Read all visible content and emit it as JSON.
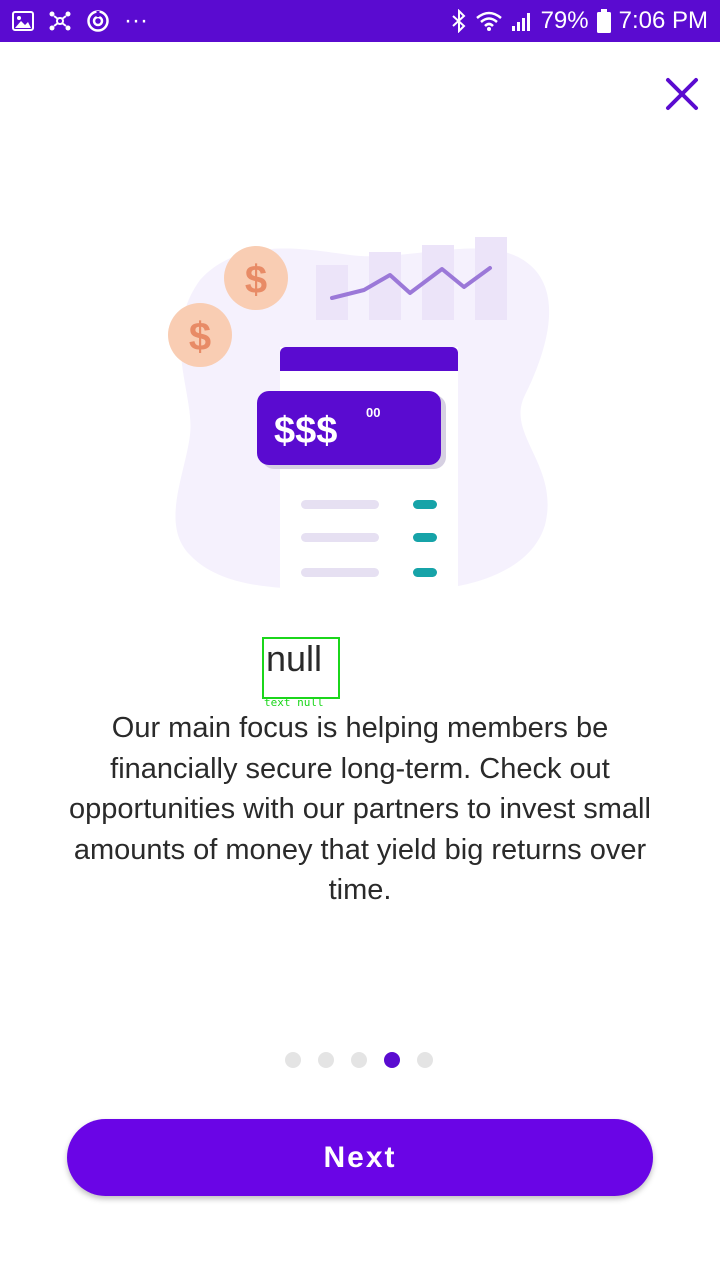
{
  "status_bar": {
    "left_icons": [
      "image-icon",
      "network-icon",
      "sync-icon",
      "more-dots-icon"
    ],
    "right_icons": [
      "bluetooth-icon",
      "wifi-icon",
      "signal-icon",
      "battery-icon"
    ],
    "more_text": "···",
    "battery_percent": "79%",
    "time": "7:06 PM"
  },
  "close": {
    "icon": "close-icon"
  },
  "illustration": {
    "coin_symbol": "$",
    "card_amount": "$$$",
    "card_cents": "00"
  },
  "title": "null",
  "debug_label": "text null",
  "body_text": "Our main focus is helping members be financially secure long-term. Check out opportunities with our partners to invest small amounts of money that yield big returns over time.",
  "pager": {
    "count": 5,
    "active_index": 3
  },
  "next_label": "Next",
  "colors": {
    "brand": "#5a0bd0",
    "button": "#6a05e6",
    "teal": "#16a3a8",
    "coin": "#f9cdb3",
    "coin_symbol": "#e88b66",
    "blob": "#f5f1fd",
    "bars": "#ece4f9",
    "trend": "#9b78d8"
  }
}
